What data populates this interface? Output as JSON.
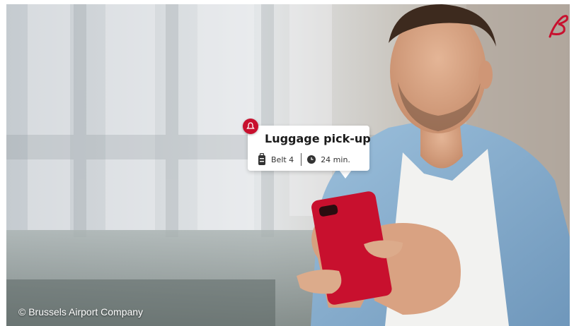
{
  "card": {
    "title": "Luggage pick-up",
    "belt": "Belt 4",
    "time": "24 min.",
    "icons": [
      "alert-pin-icon",
      "suitcase-icon",
      "clock-icon"
    ],
    "accent": "#c8102e"
  },
  "copyright": "© Brussels Airport Company",
  "brand_logo": "brussels-airlines-logo"
}
